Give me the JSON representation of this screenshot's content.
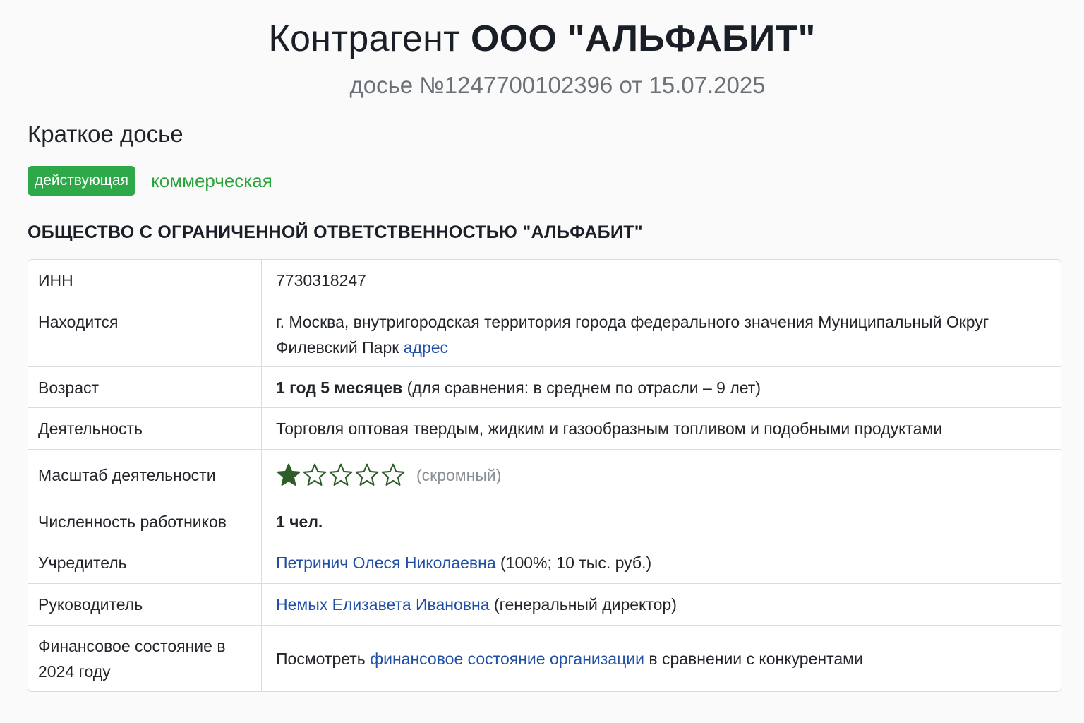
{
  "header": {
    "title_prefix": "Контрагент",
    "title_name": "ООО \"АЛЬФАБИТ\"",
    "subtitle": "досье №1247700102396 от 15.07.2025"
  },
  "section": {
    "title": "Краткое досье",
    "status_badge": "действующая",
    "type_label": "коммерческая"
  },
  "org_full_name": "ОБЩЕСТВО С ОГРАНИЧЕННОЙ ОТВЕТСТВЕННОСТЬЮ \"АЛЬФАБИТ\"",
  "details": {
    "inn": {
      "label": "ИНН",
      "value": "7730318247"
    },
    "location": {
      "label": "Находится",
      "line1": "г. Москва, внутригородская территория города федерального значения Муниципальный Округ",
      "line2": "Филевский Парк",
      "link": "адрес"
    },
    "age": {
      "label": "Возраст",
      "value": "1 год 5 месяцев",
      "note": "(для сравнения: в среднем по отрасли – 9 лет)"
    },
    "activity": {
      "label": "Деятельность",
      "value": "Торговля оптовая твердым, жидким и газообразным топливом и подобными продуктами"
    },
    "scale": {
      "label": "Масштаб деятельности",
      "stars_filled": 1,
      "stars_total": 5,
      "text": "(скромный)",
      "star_color": "#2f5d2a"
    },
    "employees": {
      "label": "Численность работников",
      "value": "1 чел."
    },
    "founder": {
      "label": "Учредитель",
      "name": "Петринич Олеся Николаевна",
      "note": "(100%; 10 тыс. руб.)"
    },
    "director": {
      "label": "Руководитель",
      "name": "Немых Елизавета Ивановна",
      "note": "(генеральный директор)"
    },
    "finance": {
      "label_line1": "Финансовое состояние в",
      "label_line2": "2024 году",
      "prefix": "Посмотреть",
      "link": "финансовое состояние организации",
      "suffix": "в сравнении с конкурентами"
    }
  },
  "colors": {
    "badge_green": "#2fa84a",
    "type_green": "#2aa33a",
    "link_blue": "#1f4fa8"
  }
}
